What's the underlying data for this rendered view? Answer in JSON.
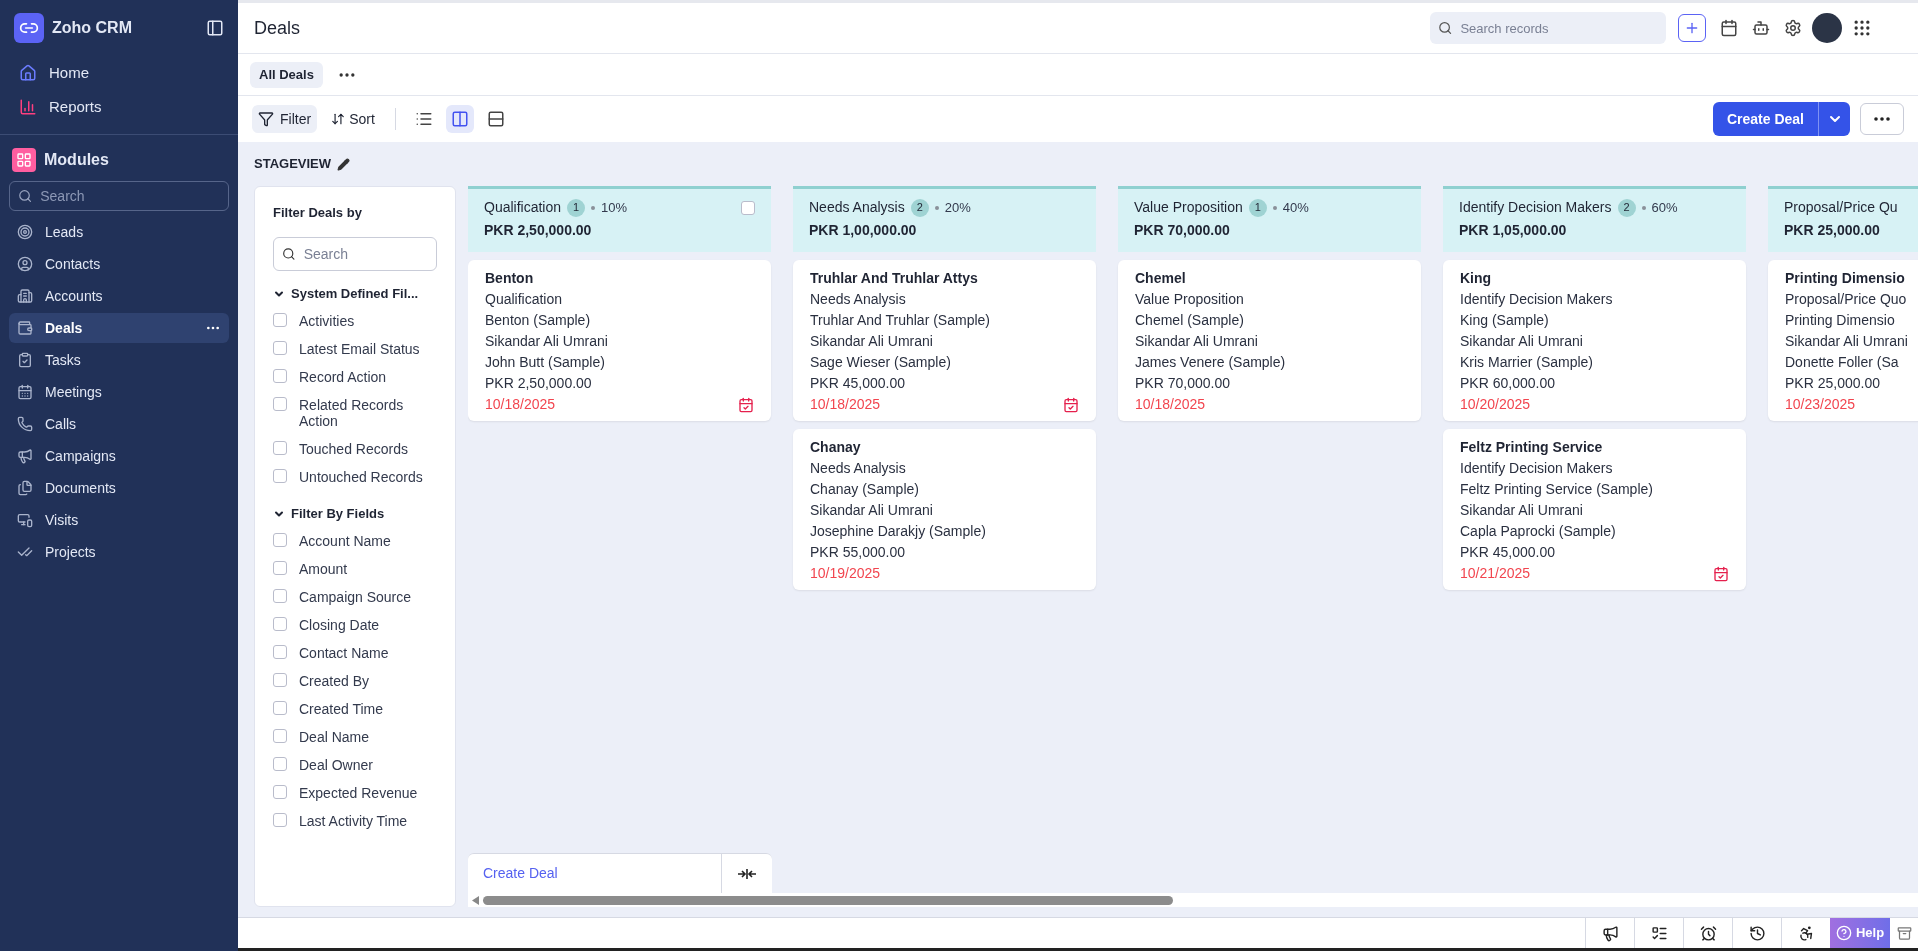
{
  "sidebar": {
    "brand": "Zoho CRM",
    "top_items": [
      {
        "label": "Home",
        "selected": false
      },
      {
        "label": "Reports",
        "selected": false
      }
    ],
    "modules_title": "Modules",
    "search": {
      "placeholder": "Search"
    },
    "items": [
      {
        "label": "Leads",
        "selected": false
      },
      {
        "label": "Contacts",
        "selected": false
      },
      {
        "label": "Accounts",
        "selected": false
      },
      {
        "label": "Deals",
        "selected": true
      },
      {
        "label": "Tasks",
        "selected": false
      },
      {
        "label": "Meetings",
        "selected": false
      },
      {
        "label": "Calls",
        "selected": false
      },
      {
        "label": "Campaigns",
        "selected": false
      },
      {
        "label": "Documents",
        "selected": false
      },
      {
        "label": "Visits",
        "selected": false
      },
      {
        "label": "Projects",
        "selected": false
      }
    ]
  },
  "header": {
    "title": "Deals",
    "search": {
      "placeholder": "Search records"
    }
  },
  "tabs": [
    {
      "label": "All Deals",
      "selected": true
    }
  ],
  "toolbar": {
    "filter": "Filter",
    "sort": "Sort",
    "views": [
      {
        "selected": false
      },
      {
        "selected": true
      },
      {
        "selected": false
      }
    ],
    "create": "Create Deal"
  },
  "stageview": "STAGEVIEW",
  "filter_panel": {
    "title": "Filter Deals by",
    "search": {
      "placeholder": "Search"
    },
    "groups": [
      {
        "title": "System Defined Fil...",
        "expanded": true,
        "items": [
          {
            "label": "Activities",
            "checked": false
          },
          {
            "label": "Latest Email Status",
            "checked": false
          },
          {
            "label": "Record Action",
            "checked": false
          },
          {
            "label": "Related Records Action",
            "checked": false
          },
          {
            "label": "Touched Records",
            "checked": false
          },
          {
            "label": "Untouched Records",
            "checked": false
          }
        ]
      },
      {
        "title": "Filter By Fields",
        "expanded": true,
        "items": [
          {
            "label": "Account Name",
            "checked": false
          },
          {
            "label": "Amount",
            "checked": false
          },
          {
            "label": "Campaign Source",
            "checked": false
          },
          {
            "label": "Closing Date",
            "checked": false
          },
          {
            "label": "Contact Name",
            "checked": false
          },
          {
            "label": "Created By",
            "checked": false
          },
          {
            "label": "Created Time",
            "checked": false
          },
          {
            "label": "Deal Name",
            "checked": false
          },
          {
            "label": "Deal Owner",
            "checked": false
          },
          {
            "label": "Expected Revenue",
            "checked": false
          },
          {
            "label": "Last Activity Time",
            "checked": false
          }
        ]
      }
    ]
  },
  "columns": [
    {
      "stage": "Qualification",
      "count": "1",
      "percent": "10%",
      "total": "PKR 2,50,000.00",
      "select_all": {
        "checked": false
      },
      "cards": [
        {
          "title": "Benton",
          "lines": [
            "Qualification",
            "Benton (Sample)",
            "Sikandar Ali Umrani",
            "John Butt (Sample)",
            "PKR 2,50,000.00"
          ],
          "date": "10/18/2025",
          "has_task": true
        }
      ]
    },
    {
      "stage": "Needs Analysis",
      "count": "2",
      "percent": "20%",
      "total": "PKR 1,00,000.00",
      "cards": [
        {
          "title": "Truhlar And Truhlar Attys",
          "lines": [
            "Needs Analysis",
            "Truhlar And Truhlar (Sample)",
            "Sikandar Ali Umrani",
            "Sage Wieser (Sample)",
            "PKR 45,000.00"
          ],
          "date": "10/18/2025",
          "has_task": true
        },
        {
          "title": "Chanay",
          "lines": [
            "Needs Analysis",
            "Chanay (Sample)",
            "Sikandar Ali Umrani",
            "Josephine Darakjy (Sample)",
            "PKR 55,000.00"
          ],
          "date": "10/19/2025",
          "has_task": false
        }
      ]
    },
    {
      "stage": "Value Proposition",
      "count": "1",
      "percent": "40%",
      "total": "PKR 70,000.00",
      "cards": [
        {
          "title": "Chemel",
          "lines": [
            "Value Proposition",
            "Chemel (Sample)",
            "Sikandar Ali Umrani",
            "James Venere (Sample)",
            "PKR 70,000.00"
          ],
          "date": "10/18/2025",
          "has_task": false
        }
      ]
    },
    {
      "stage": "Identify Decision Makers",
      "count": "2",
      "percent": "60%",
      "total": "PKR 1,05,000.00",
      "cards": [
        {
          "title": "King",
          "lines": [
            "Identify Decision Makers",
            "King (Sample)",
            "Sikandar Ali Umrani",
            "Kris Marrier (Sample)",
            "PKR 60,000.00"
          ],
          "date": "10/20/2025",
          "has_task": false
        },
        {
          "title": "Feltz Printing Service",
          "lines": [
            "Identify Decision Makers",
            "Feltz Printing Service (Sample)",
            "Sikandar Ali Umrani",
            "Capla Paprocki (Sample)",
            "PKR 45,000.00"
          ],
          "date": "10/21/2025",
          "has_task": true
        }
      ]
    },
    {
      "stage": "Proposal/Price Qu",
      "total": "PKR 25,000.00",
      "cards": [
        {
          "title": "Printing Dimensio",
          "lines": [
            "Proposal/Price Quo",
            "Printing Dimensio",
            "Sikandar Ali Umrani",
            "Donette Foller (Sa",
            "PKR 25,000.00"
          ],
          "date": "10/23/2025",
          "has_task": false
        }
      ]
    }
  ],
  "create_deal_link": "Create Deal",
  "bottom_bar": {
    "help": "Help"
  }
}
